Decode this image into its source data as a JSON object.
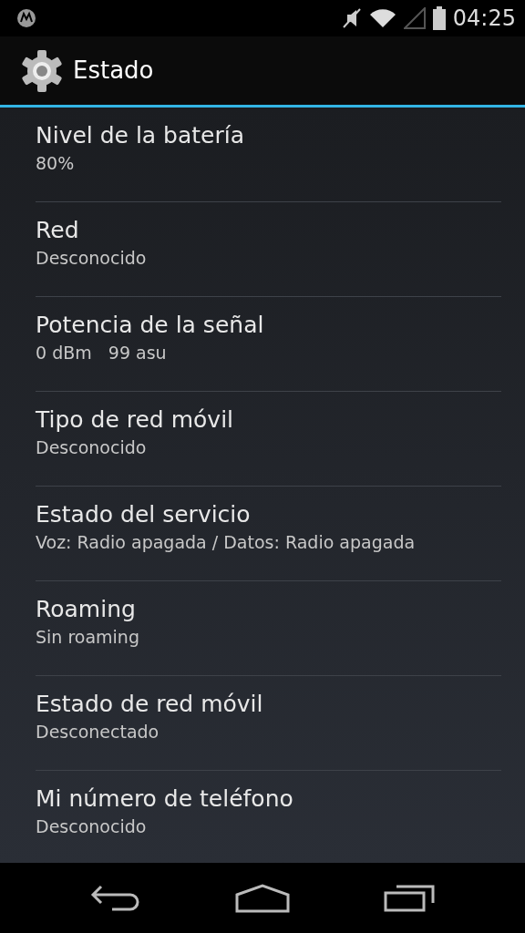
{
  "status_bar": {
    "time": "04:25"
  },
  "action_bar": {
    "title": "Estado"
  },
  "items": [
    {
      "title": "Nivel de la batería",
      "summary": "80%"
    },
    {
      "title": "Red",
      "summary": "Desconocido"
    },
    {
      "title": "Potencia de la señal",
      "summary": "0 dBm   99 asu"
    },
    {
      "title": "Tipo de red móvil",
      "summary": "Desconocido"
    },
    {
      "title": "Estado del servicio",
      "summary": "Voz: Radio apagada / Datos: Radio apagada"
    },
    {
      "title": "Roaming",
      "summary": "Sin roaming"
    },
    {
      "title": "Estado de red móvil",
      "summary": "Desconectado"
    },
    {
      "title": "Mi número de teléfono",
      "summary": "Desconocido"
    }
  ]
}
